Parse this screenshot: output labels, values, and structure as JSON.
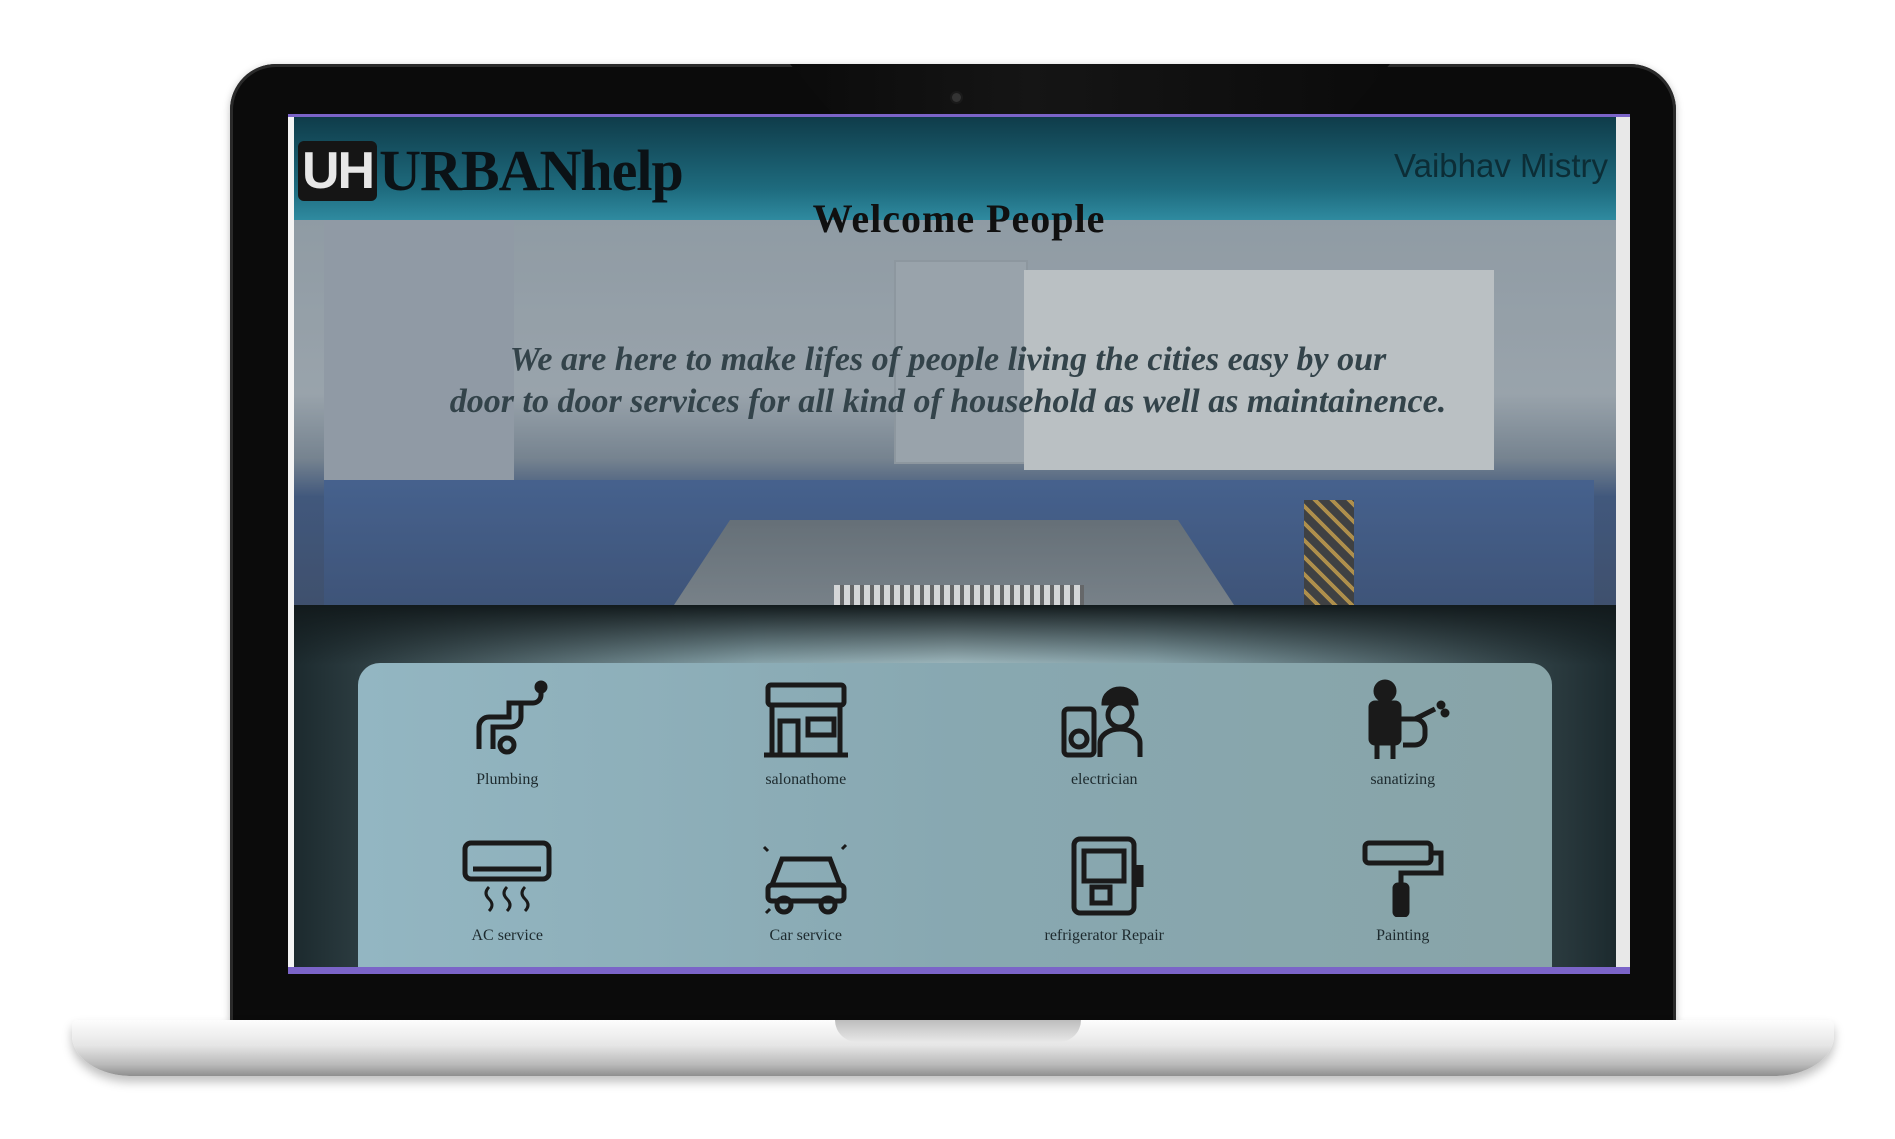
{
  "app": {
    "brand_mark": "UH",
    "brand_name": "URBANhelp",
    "user_name": "Vaibhav Mistry"
  },
  "hero": {
    "heading": "Welcome People",
    "tagline_line1": "We are here to make lifes of people living the cities easy by our",
    "tagline_line2": "door to door services for all kind of household as well as maintainence."
  },
  "services": [
    {
      "label": "Plumbing",
      "icon": "plumbing-pipe-icon"
    },
    {
      "label": "salonathome",
      "icon": "salon-storefront-icon"
    },
    {
      "label": "electrician",
      "icon": "electrician-icon"
    },
    {
      "label": "sanatizing",
      "icon": "sanitizing-sprayer-icon"
    },
    {
      "label": "AC service",
      "icon": "air-conditioner-icon"
    },
    {
      "label": "Car service",
      "icon": "car-service-icon"
    },
    {
      "label": "refrigerator Repair",
      "icon": "refrigerator-icon"
    },
    {
      "label": "Painting",
      "icon": "paint-roller-icon"
    }
  ],
  "colors": {
    "header_top": "#0f3c4a",
    "header_bottom": "#2f8aa0",
    "panel": "#88a8b1",
    "accent_border": "#7b64c8"
  }
}
